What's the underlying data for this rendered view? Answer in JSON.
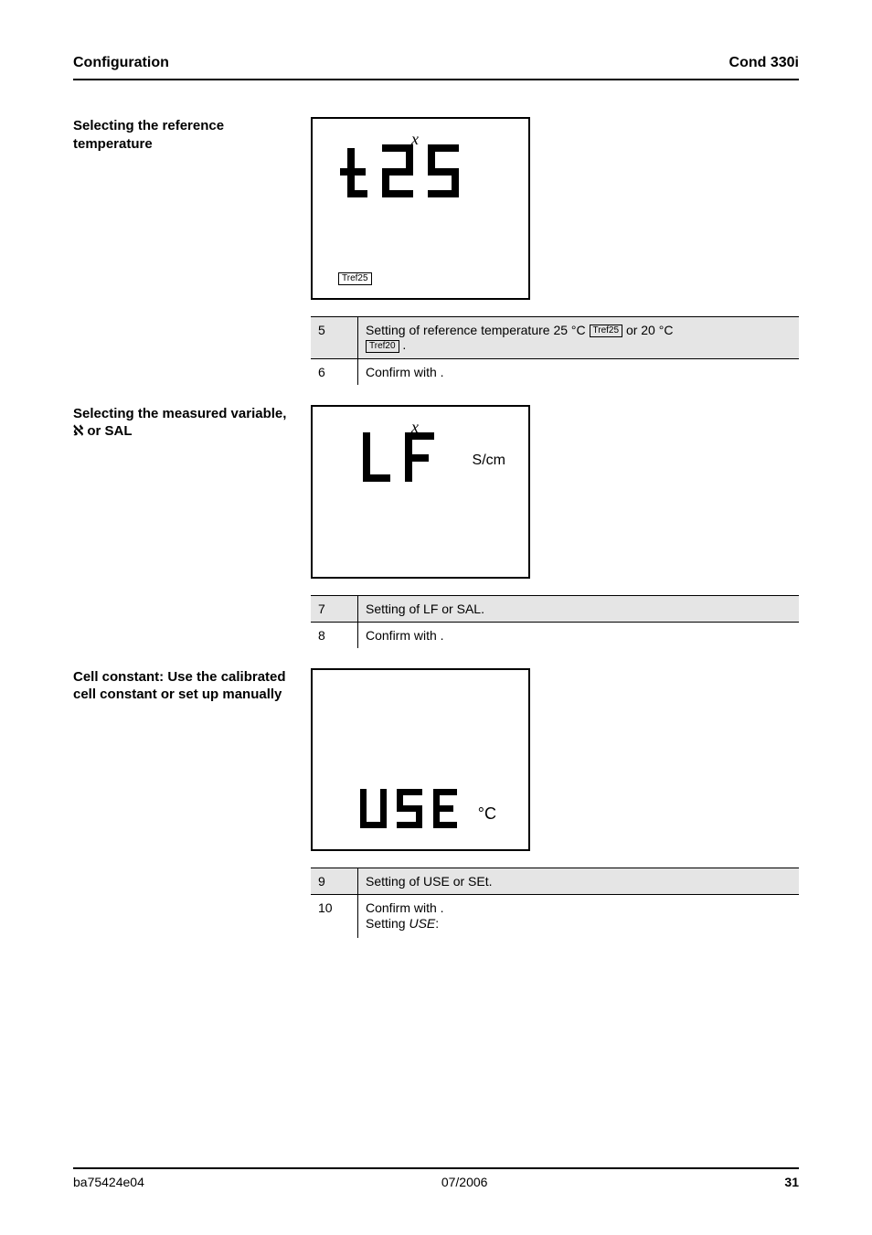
{
  "header": {
    "left": "Configuration",
    "right": "Cond 330i"
  },
  "section1": {
    "title": "Selecting the reference temperature",
    "script_x_icon": "x",
    "seg_display": "t25",
    "indicator": "Tref25",
    "table": {
      "header": {
        "col1": "5",
        "col2_prefix": "Setting of reference temperature 25 °C  ",
        "col2_box": "Tref25",
        "col2_suffix": "  or 20 °C"
      },
      "row1": {
        "col1": "",
        "col2_box": "Tref20",
        "col2_suffix": "."
      },
      "row2": {
        "col1": "6",
        "col2": "Confirm with ."
      }
    }
  },
  "section2": {
    "title_prefix": "Selecting the measured variable,",
    "title_body": " ℵ or SAL",
    "script_x_icon": "x",
    "seg_display": "LF",
    "unit_right": "S/cm",
    "table": {
      "header": {
        "col1": "7",
        "col2": "Setting of LF or SAL."
      },
      "row": {
        "col1": "8",
        "col2": "Confirm with ."
      }
    }
  },
  "section3": {
    "title": "Cell constant: Use the calibrated cell constant or set up manually",
    "seg_display": "USE",
    "deg_c": "°C",
    "table": {
      "header": {
        "col1": "9",
        "col2": "Setting of USE or SEt."
      },
      "row_step1": {
        "col1": "10",
        "col2": "Confirm with ."
      },
      "row_step2": {
        "col1": "",
        "col2_label": "Setting",
        "col2_em": "USE",
        "col2_tail": ":"
      }
    }
  },
  "footer": {
    "model": "ba75424e04",
    "date": "07/2006",
    "page": "31"
  }
}
